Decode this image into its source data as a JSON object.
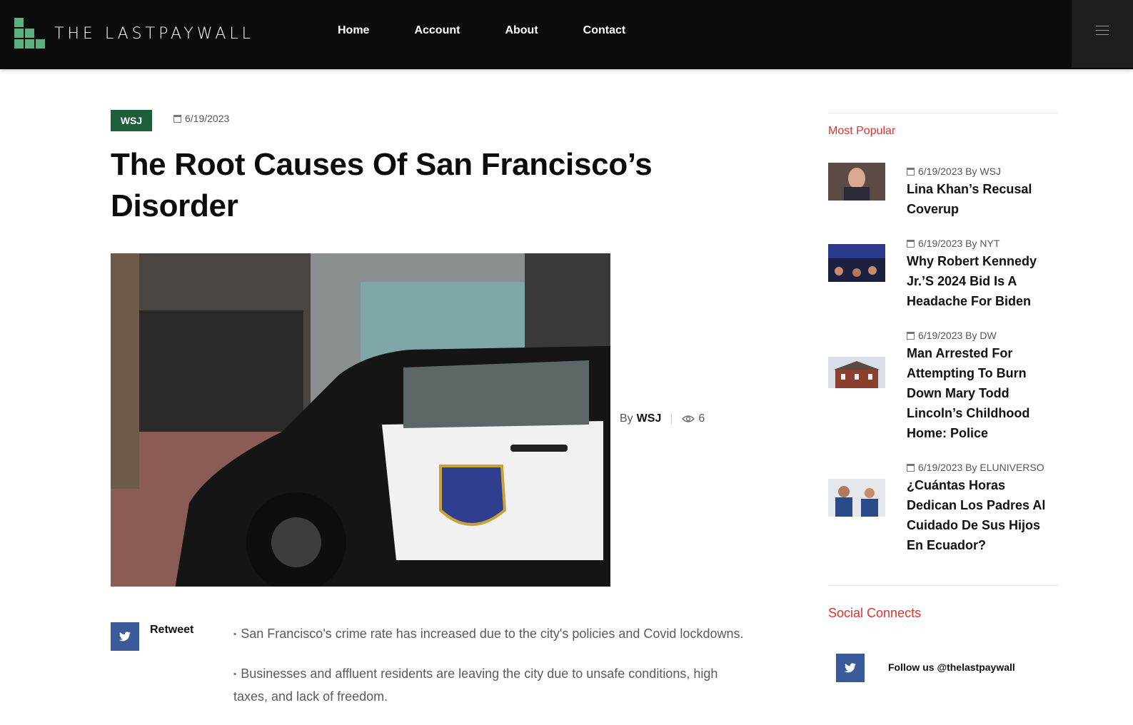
{
  "site": {
    "brand": "THE LASTPAYWALL"
  },
  "nav": [
    {
      "label": "Home"
    },
    {
      "label": "Account"
    },
    {
      "label": "About"
    },
    {
      "label": "Contact"
    }
  ],
  "article": {
    "tag": "WSJ",
    "date": "6/19/2023",
    "title": "The Root Causes Of San Francisco’s Disorder",
    "byline_prefix": "By",
    "author": "WSJ",
    "views": "6",
    "retweet": "Retweet",
    "bullets": [
      "San Francisco's crime rate has increased due to the city's policies and Covid lockdowns.",
      "Businesses and affluent residents are leaving the city due to unsafe conditions, high taxes, and lack of freedom."
    ]
  },
  "sidebar": {
    "most_popular_title": "Most Popular",
    "posts": [
      {
        "meta": "6/19/2023 By WSJ",
        "title": "Lina Khan’s Recusal Coverup"
      },
      {
        "meta": "6/19/2023 By NYT",
        "title": "Why Robert Kennedy Jr.’S 2024 Bid Is A Headache For Biden"
      },
      {
        "meta": "6/19/2023 By DW",
        "title": "Man Arrested For Attempting To Burn Down Mary Todd Lincoln’s Childhood Home: Police"
      },
      {
        "meta": "6/19/2023 By ELUNIVERSO",
        "title": "¿Cuántas Horas Dedican Los Padres Al Cuidado De Sus Hijos En Ecuador?"
      }
    ],
    "social_title": "Social Connects",
    "follow_text": "Follow us @thelastpaywall"
  },
  "colors": {
    "brand_green": "#5db07d",
    "tag_green": "#1c5e3a",
    "accent_red": "#e03030",
    "twitter_blue": "#3b5a9a"
  }
}
